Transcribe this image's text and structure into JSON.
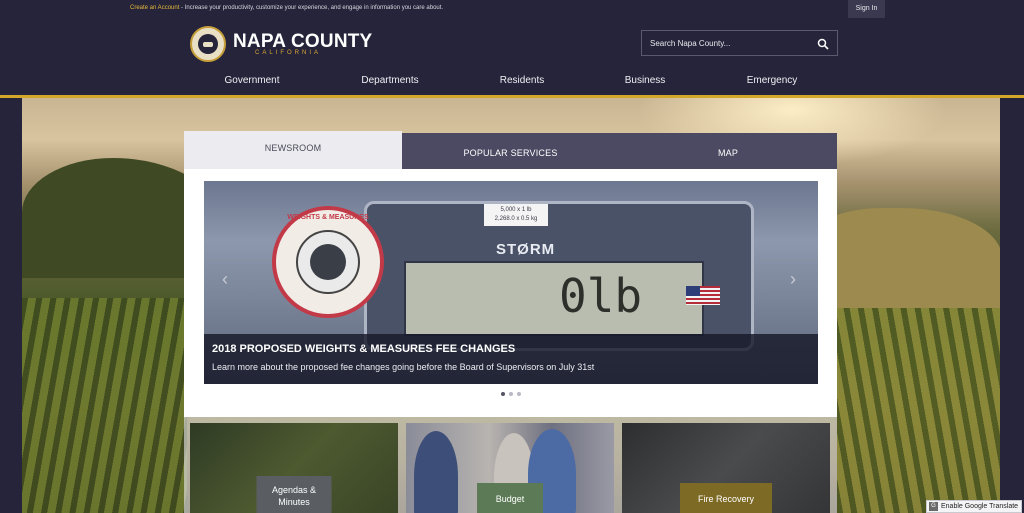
{
  "topbar": {
    "account_link": "Create an Account",
    "message": " - Increase your productivity, customize your experience, and engage in information you care about.",
    "sign_in": "Sign In"
  },
  "header": {
    "title": "NAPA COUNTY",
    "subtitle": "CALIFORNIA",
    "search_placeholder": "Search Napa County..."
  },
  "nav": {
    "items": [
      "Government",
      "Departments",
      "Residents",
      "Business",
      "Emergency"
    ]
  },
  "tabs": {
    "items": [
      "NEWSROOM",
      "POPULAR SERVICES",
      "MAP"
    ],
    "active": "NEWSROOM"
  },
  "slide": {
    "headline": "2018 PROPOSED WEIGHTS & MEASURES FEE CHANGES",
    "description": "Learn more about the proposed fee changes going before the Board of Supervisors on July 31st",
    "scale_brand": "STØRM",
    "scale_digits": "0lb",
    "tag_line1": "5,000 x 1 lb",
    "tag_line2": "2,268.0 x 0.5 kg",
    "seal_text": "WEIGHTS & MEASURES",
    "current_slide": 1,
    "total_slides": 3
  },
  "cards": {
    "items": [
      "Agendas & Minutes",
      "Budget",
      "Fire Recovery"
    ]
  },
  "translate": {
    "label": "Enable Google Translate"
  },
  "colors": {
    "header_bg": "#25243a",
    "accent_gold": "#d3a72a",
    "tab_inactive": "#4b4a62",
    "tab_active": "#ecebef"
  }
}
